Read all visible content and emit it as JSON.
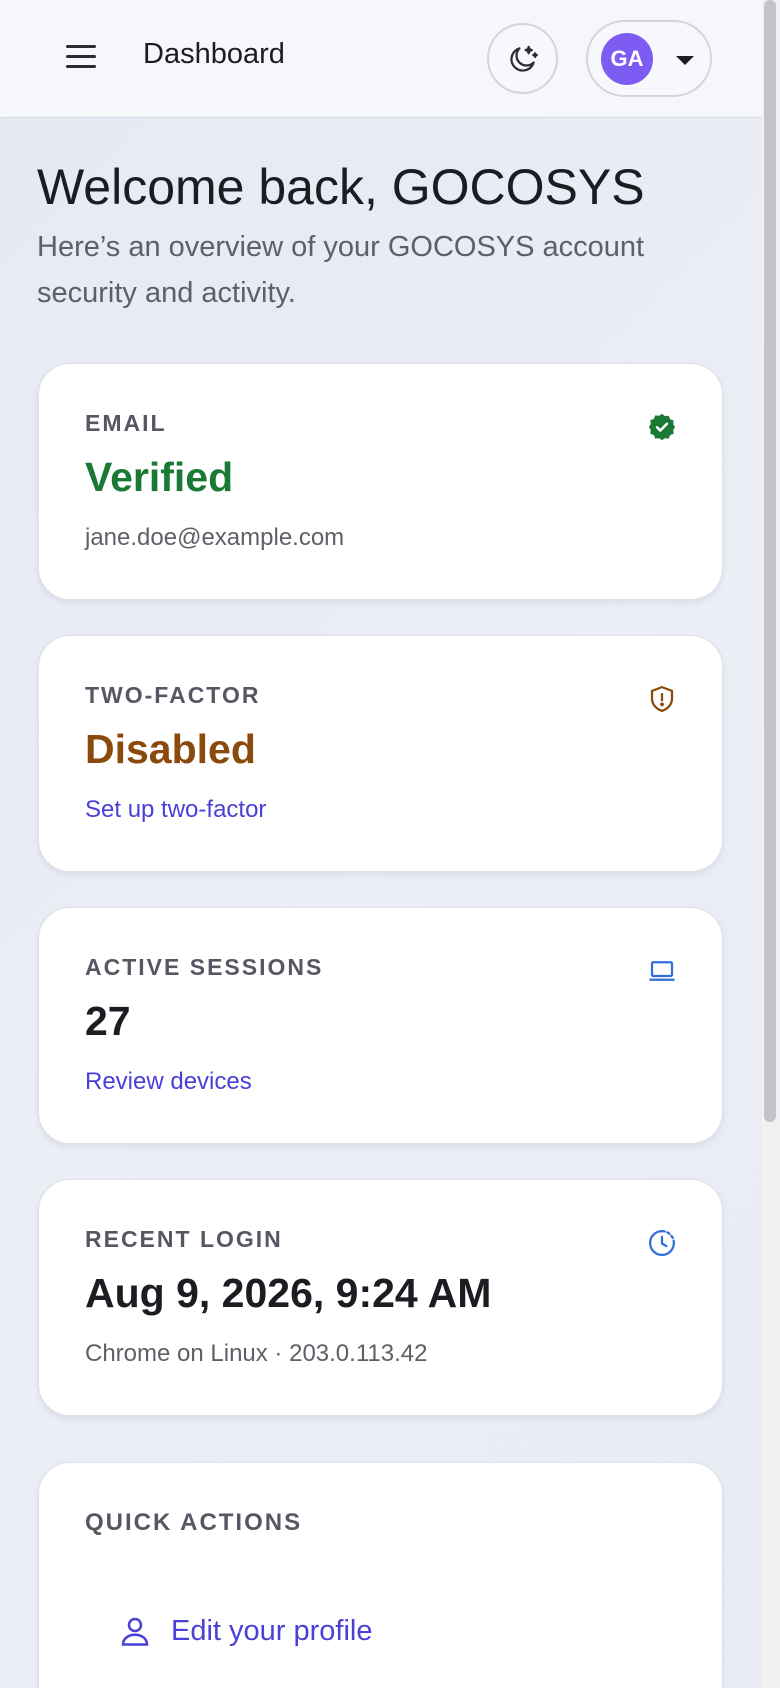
{
  "header": {
    "title": "Dashboard",
    "avatar_initials": "GA"
  },
  "welcome": {
    "title": "Welcome back, GOCOSYS",
    "subtitle": "Here’s an overview of your GOCOSYS account security and activity."
  },
  "cards": {
    "email": {
      "label": "EMAIL",
      "value": "Verified",
      "detail": "jane.doe@example.com",
      "color": "#1a7a35",
      "icon": "verified-badge-icon"
    },
    "two_factor": {
      "label": "TWO-FACTOR",
      "value": "Disabled",
      "link": "Set up two-factor",
      "color": "#8a4a0b",
      "icon": "shield-alert-icon"
    },
    "sessions": {
      "label": "ACTIVE SESSIONS",
      "value": "27",
      "link": "Review devices",
      "color": "#1c1d22",
      "icon": "laptop-icon"
    },
    "recent_login": {
      "label": "RECENT LOGIN",
      "value": "Aug 9, 2026, 9:24 AM",
      "detail": "Chrome on Linux · 203.0.113.42",
      "color": "#1c1d22",
      "icon": "clock-icon"
    }
  },
  "quick_actions": {
    "label": "QUICK ACTIONS",
    "items": [
      {
        "label": "Edit your profile",
        "icon": "user-icon"
      }
    ]
  },
  "colors": {
    "accent": "#4a40d8",
    "avatar": "#7c5cf2",
    "info_icon": "#2f6fd6"
  }
}
